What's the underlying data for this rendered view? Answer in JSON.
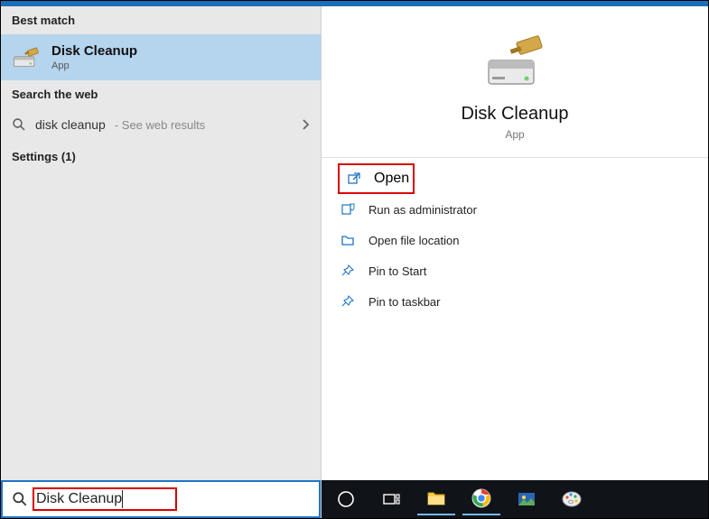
{
  "left": {
    "best_match_header": "Best match",
    "best_match": {
      "title": "Disk Cleanup",
      "subtitle": "App"
    },
    "web_header": "Search the web",
    "web_query": "disk cleanup",
    "web_hint": "- See web results",
    "settings_label": "Settings (1)"
  },
  "right": {
    "title": "Disk Cleanup",
    "subtitle": "App",
    "actions": {
      "open": "Open",
      "run_admin": "Run as administrator",
      "open_loc": "Open file location",
      "pin_start": "Pin to Start",
      "pin_taskbar": "Pin to taskbar"
    }
  },
  "search": {
    "value": "Disk Cleanup"
  },
  "taskbar": {
    "items": [
      "cortana",
      "task-view",
      "file-explorer",
      "chrome",
      "photos",
      "paint"
    ]
  }
}
